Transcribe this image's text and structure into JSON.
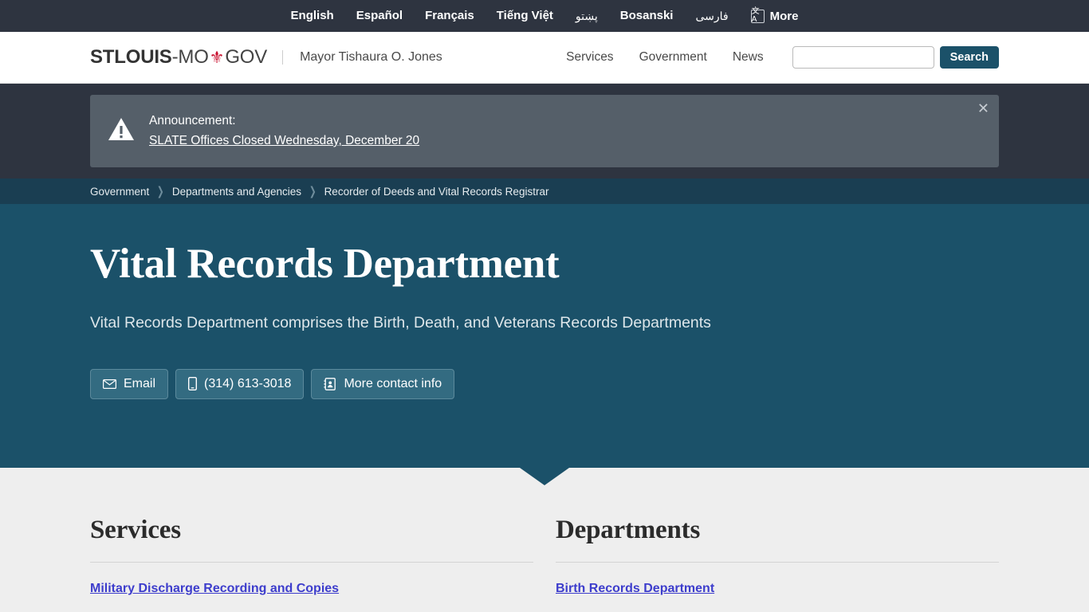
{
  "language_bar": {
    "items": [
      {
        "label": "English",
        "rtl": false
      },
      {
        "label": "Español",
        "rtl": false
      },
      {
        "label": "Français",
        "rtl": false
      },
      {
        "label": "Tiếng Việt",
        "rtl": false
      },
      {
        "label": "پښتو",
        "rtl": true
      },
      {
        "label": "Bosanski",
        "rtl": false
      },
      {
        "label": "فارسی",
        "rtl": true
      }
    ],
    "more_label": "More",
    "translate_icon_glyph": "文A",
    "background_color": "#2e3440"
  },
  "header": {
    "logo": {
      "part1": "STLOUIS",
      "part2": "-MO",
      "fleur_glyph": "⚜",
      "part3": "GOV",
      "fleur_color": "#c8102e"
    },
    "mayor": "Mayor Tishaura O. Jones",
    "nav": [
      {
        "label": "Services"
      },
      {
        "label": "Government"
      },
      {
        "label": "News"
      }
    ],
    "search": {
      "value": "",
      "placeholder": "",
      "button_label": "Search",
      "button_color": "#1b5169"
    }
  },
  "announcement": {
    "label": "Announcement:",
    "link_text": "SLATE Offices Closed Wednesday, December 20",
    "close_glyph": "✕",
    "box_color": "#555f69",
    "outer_color": "#2e3440"
  },
  "breadcrumb": {
    "separator": "❯",
    "items": [
      {
        "label": "Government"
      },
      {
        "label": "Departments and Agencies"
      },
      {
        "label": "Recorder of Deeds and Vital Records Registrar"
      }
    ],
    "background_color": "#1a3e52"
  },
  "hero": {
    "title": "Vital Records Department",
    "subtitle": "Vital Records Department comprises the Birth, Death, and Veterans Records Departments",
    "background_color": "#1b5169",
    "buttons": [
      {
        "label": "Email",
        "icon": "envelope-icon"
      },
      {
        "label": "(314) 613-3018",
        "icon": "mobile-phone-icon"
      },
      {
        "label": "More contact info",
        "icon": "address-book-icon"
      }
    ]
  },
  "columns": [
    {
      "heading": "Services",
      "links": [
        {
          "label": "Military Discharge Recording and Copies"
        }
      ]
    },
    {
      "heading": "Departments",
      "links": [
        {
          "label": "Birth Records Department"
        }
      ]
    }
  ]
}
